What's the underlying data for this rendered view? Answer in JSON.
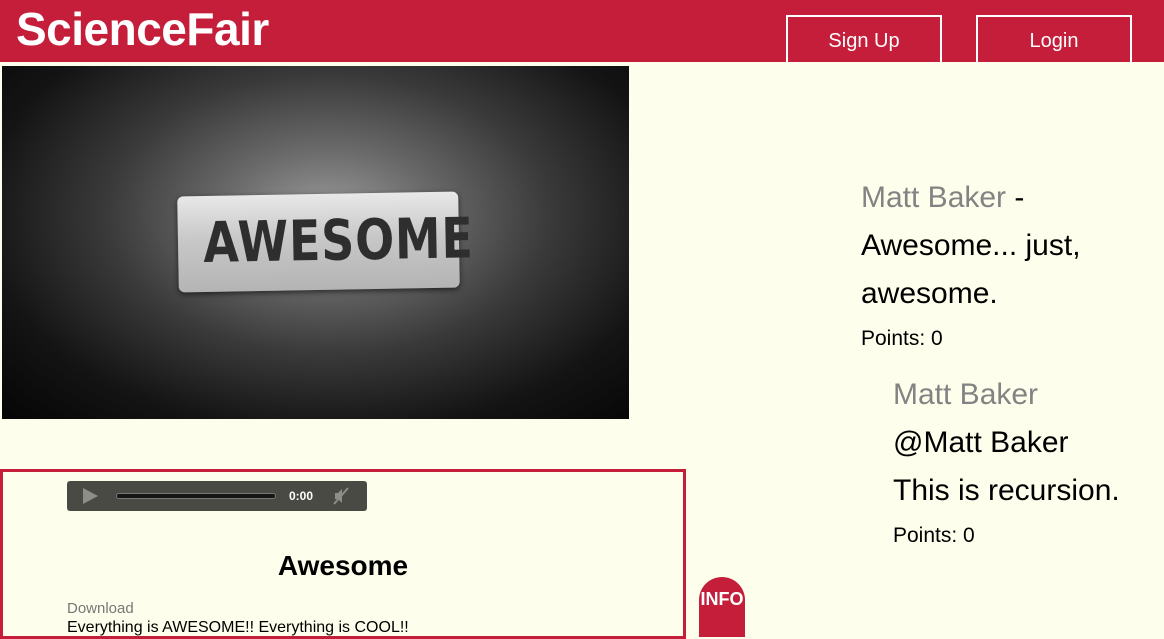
{
  "header": {
    "logo": "ScienceFair",
    "signup_label": "Sign Up",
    "login_label": "Login",
    "brand_color": "#c41e3a"
  },
  "media": {
    "image_text": "AWESOME"
  },
  "audio_player": {
    "time": "0:00",
    "progress": 0
  },
  "project": {
    "title": "Awesome",
    "download_label": "Download",
    "description": "Everything is AWESOME!! Everything is COOL!!"
  },
  "info_button": {
    "label": "INFO"
  },
  "comments": [
    {
      "author": "Matt Baker",
      "separator": " - ",
      "text": "Awesome... just, awesome.",
      "points": "Points: 0",
      "replies": [
        {
          "author": "Matt Baker",
          "text": "@Matt Baker This is recursion.",
          "points": "Points: 0"
        }
      ]
    }
  ]
}
